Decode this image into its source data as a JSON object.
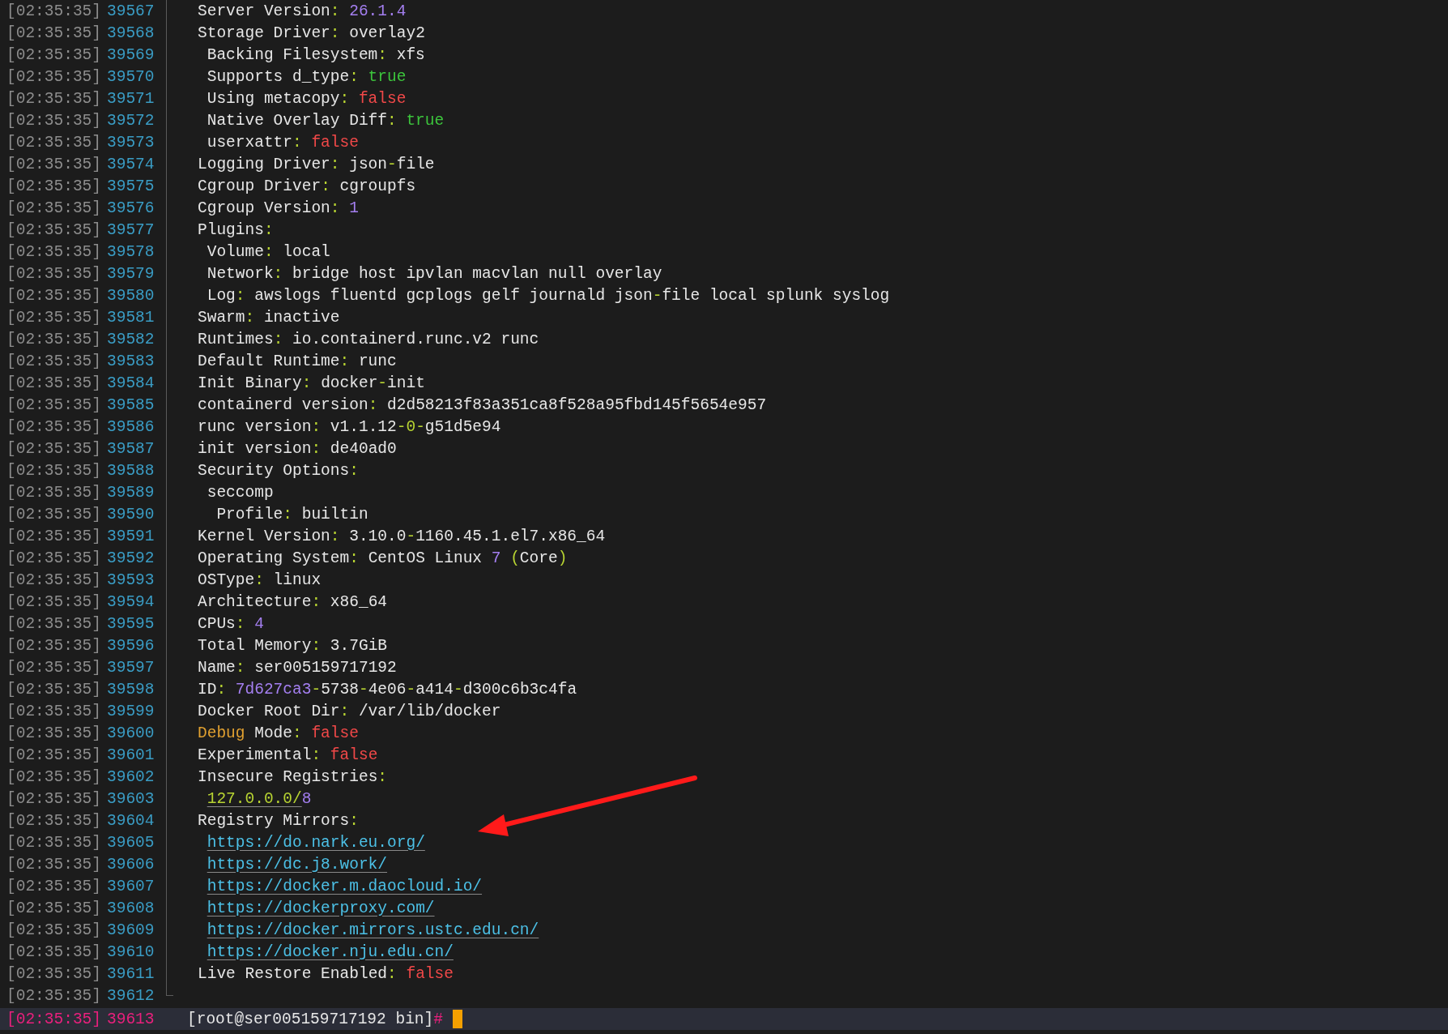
{
  "lines": [
    {
      "time": "[02:35:35]",
      "number": "39567",
      "segments": [
        {
          "kind": "text",
          "text": "Server Version"
        },
        {
          "kind": "punct",
          "text": ":"
        },
        {
          "kind": "number",
          "text": "26.1.4"
        }
      ]
    },
    {
      "time": "[02:35:35]",
      "number": "39568",
      "segments": [
        {
          "kind": "text",
          "text": "Storage Driver"
        },
        {
          "kind": "punct",
          "text": ":"
        },
        {
          "kind": "text",
          "text": "overlay2"
        }
      ],
      "children": [
        {
          "time": "[02:35:35]",
          "number": "39569",
          "segments": [
            {
              "kind": "text",
              "text": "Backing Filesystem"
            },
            {
              "kind": "punct",
              "text": ":"
            },
            {
              "kind": "text",
              "text": "xfs"
            }
          ]
        },
        {
          "time": "[02:35:35]",
          "number": "39570",
          "segments": [
            {
              "kind": "text",
              "text": "Supports d_type"
            },
            {
              "kind": "punct",
              "text": ":"
            },
            {
              "kind": "true",
              "text": "true"
            }
          ]
        },
        {
          "time": "[02:35:35]",
          "number": "39571",
          "segments": [
            {
              "kind": "text",
              "text": "Using metacopy"
            },
            {
              "kind": "punct",
              "text": ":"
            },
            {
              "kind": "false",
              "text": "false"
            }
          ]
        },
        {
          "time": "[02:35:35]",
          "number": "39572",
          "segments": [
            {
              "kind": "text",
              "text": "Native Overlay Diff"
            },
            {
              "kind": "punct",
              "text": ":"
            },
            {
              "kind": "true",
              "text": "true"
            }
          ]
        },
        {
          "time": "[02:35:35]",
          "number": "39573",
          "segments": [
            {
              "kind": "text",
              "text": "userxattr"
            },
            {
              "kind": "punct",
              "text": ":"
            },
            {
              "kind": "false",
              "text": "false"
            }
          ]
        }
      ]
    },
    {
      "time": "[02:35:35]",
      "number": "39574",
      "segments": [
        {
          "kind": "text",
          "text": "Logging Driver"
        },
        {
          "kind": "punct",
          "text": ":"
        },
        {
          "kind": "text",
          "text": "json"
        },
        {
          "kind": "dash",
          "text": "-"
        },
        {
          "kind": "text",
          "text": "file"
        }
      ]
    },
    {
      "time": "[02:35:35]",
      "number": "39575",
      "segments": [
        {
          "kind": "text",
          "text": "Cgroup Driver"
        },
        {
          "kind": "punct",
          "text": ":"
        },
        {
          "kind": "text",
          "text": "cgroupfs"
        }
      ]
    },
    {
      "time": "[02:35:35]",
      "number": "39576",
      "segments": [
        {
          "kind": "text",
          "text": "Cgroup Version"
        },
        {
          "kind": "punct",
          "text": ":"
        },
        {
          "kind": "number",
          "text": "1"
        }
      ]
    },
    {
      "time": "[02:35:35]",
      "number": "39577",
      "segments": [
        {
          "kind": "text",
          "text": "Plugins"
        },
        {
          "kind": "punct",
          "text": ":"
        }
      ],
      "children": [
        {
          "time": "[02:35:35]",
          "number": "39578",
          "segments": [
            {
              "kind": "text",
              "text": "Volume"
            },
            {
              "kind": "punct",
              "text": ":"
            },
            {
              "kind": "text",
              "text": "local"
            }
          ]
        },
        {
          "time": "[02:35:35]",
          "number": "39579",
          "segments": [
            {
              "kind": "text",
              "text": "Network"
            },
            {
              "kind": "punct",
              "text": ":"
            },
            {
              "kind": "text",
              "text": "bridge host ipvlan macvlan null overlay"
            }
          ]
        },
        {
          "time": "[02:35:35]",
          "number": "39580",
          "segments": [
            {
              "kind": "text",
              "text": "Log"
            },
            {
              "kind": "punct",
              "text": ":"
            },
            {
              "kind": "text",
              "text": "awslogs fluentd gcplogs gelf journald json"
            },
            {
              "kind": "dash",
              "text": "-"
            },
            {
              "kind": "text",
              "text": "file local splunk syslog"
            }
          ]
        }
      ]
    },
    {
      "time": "[02:35:35]",
      "number": "39581",
      "segments": [
        {
          "kind": "text",
          "text": "Swarm"
        },
        {
          "kind": "punct",
          "text": ":"
        },
        {
          "kind": "text",
          "text": "inactive"
        }
      ]
    },
    {
      "time": "[02:35:35]",
      "number": "39582",
      "segments": [
        {
          "kind": "text",
          "text": "Runtimes"
        },
        {
          "kind": "punct",
          "text": ":"
        },
        {
          "kind": "text",
          "text": "io.containerd.runc.v2 runc"
        }
      ]
    },
    {
      "time": "[02:35:35]",
      "number": "39583",
      "segments": [
        {
          "kind": "text",
          "text": "Default Runtime"
        },
        {
          "kind": "punct",
          "text": ":"
        },
        {
          "kind": "text",
          "text": "runc"
        }
      ]
    },
    {
      "time": "[02:35:35]",
      "number": "39584",
      "segments": [
        {
          "kind": "text",
          "text": "Init Binary"
        },
        {
          "kind": "punct",
          "text": ":"
        },
        {
          "kind": "text",
          "text": "docker"
        },
        {
          "kind": "dash",
          "text": "-"
        },
        {
          "kind": "text",
          "text": "init"
        }
      ]
    },
    {
      "time": "[02:35:35]",
      "number": "39585",
      "segments": [
        {
          "kind": "text",
          "text": "containerd version"
        },
        {
          "kind": "punct",
          "text": ":"
        },
        {
          "kind": "text",
          "text": "d2d58213f83a351ca8f528a95fbd145f5654e957"
        }
      ]
    },
    {
      "time": "[02:35:35]",
      "number": "39586",
      "segments": [
        {
          "kind": "text",
          "text": "runc version"
        },
        {
          "kind": "punct",
          "text": ":"
        },
        {
          "kind": "text",
          "text": "v1.1.12"
        },
        {
          "kind": "dash",
          "text": "-0-"
        },
        {
          "kind": "text",
          "text": "g51d5e94"
        }
      ]
    },
    {
      "time": "[02:35:35]",
      "number": "39587",
      "segments": [
        {
          "kind": "text",
          "text": "init version"
        },
        {
          "kind": "punct",
          "text": ":"
        },
        {
          "kind": "text",
          "text": "de40ad0"
        }
      ]
    },
    {
      "time": "[02:35:35]",
      "number": "39588",
      "segments": [
        {
          "kind": "text",
          "text": "Security Options"
        },
        {
          "kind": "punct",
          "text": ":"
        }
      ],
      "children": [
        {
          "time": "[02:35:35]",
          "number": "39589",
          "segments": [
            {
              "kind": "text",
              "text": "seccomp"
            }
          ],
          "children": [
            {
              "time": "[02:35:35]",
              "number": "39590",
              "segments": [
                {
                  "kind": "text",
                  "text": "Profile"
                },
                {
                  "kind": "punct",
                  "text": ":"
                },
                {
                  "kind": "text",
                  "text": "builtin"
                }
              ]
            }
          ]
        }
      ]
    },
    {
      "time": "[02:35:35]",
      "number": "39591",
      "segments": [
        {
          "kind": "text",
          "text": "Kernel Version"
        },
        {
          "kind": "punct",
          "text": ":"
        },
        {
          "kind": "text",
          "text": "3.10.0"
        },
        {
          "kind": "dash",
          "text": "-"
        },
        {
          "kind": "text",
          "text": "1160.45.1.el7.x86_64"
        }
      ]
    },
    {
      "time": "[02:35:35]",
      "number": "39592",
      "segments": [
        {
          "kind": "text",
          "text": "Operating System"
        },
        {
          "kind": "punct",
          "text": ":"
        },
        {
          "kind": "text",
          "text": "CentOS Linux "
        },
        {
          "kind": "number",
          "text": "7"
        },
        {
          "kind": "dash",
          "text": " ("
        },
        {
          "kind": "text",
          "text": "Core"
        },
        {
          "kind": "dash",
          "text": ")"
        }
      ]
    },
    {
      "time": "[02:35:35]",
      "number": "39593",
      "segments": [
        {
          "kind": "text",
          "text": "OSType"
        },
        {
          "kind": "punct",
          "text": ":"
        },
        {
          "kind": "text",
          "text": "linux"
        }
      ]
    },
    {
      "time": "[02:35:35]",
      "number": "39594",
      "segments": [
        {
          "kind": "text",
          "text": "Architecture"
        },
        {
          "kind": "punct",
          "text": ":"
        },
        {
          "kind": "text",
          "text": "x86_64"
        }
      ]
    },
    {
      "time": "[02:35:35]",
      "number": "39595",
      "segments": [
        {
          "kind": "text",
          "text": "CPUs"
        },
        {
          "kind": "punct",
          "text": ":"
        },
        {
          "kind": "number",
          "text": "4"
        }
      ]
    },
    {
      "time": "[02:35:35]",
      "number": "39596",
      "segments": [
        {
          "kind": "text",
          "text": "Total Memory"
        },
        {
          "kind": "punct",
          "text": ":"
        },
        {
          "kind": "text",
          "text": "3.7GiB"
        }
      ]
    },
    {
      "time": "[02:35:35]",
      "number": "39597",
      "segments": [
        {
          "kind": "text",
          "text": "Name"
        },
        {
          "kind": "punct",
          "text": ":"
        },
        {
          "kind": "text",
          "text": "ser005159717192"
        }
      ]
    },
    {
      "time": "[02:35:35]",
      "number": "39598",
      "segments": [
        {
          "kind": "text",
          "text": "ID"
        },
        {
          "kind": "punct",
          "text": ":"
        },
        {
          "kind": "number",
          "text": "7d627ca3"
        },
        {
          "kind": "dash",
          "text": "-"
        },
        {
          "kind": "text",
          "text": "5738"
        },
        {
          "kind": "dash",
          "text": "-"
        },
        {
          "kind": "text",
          "text": "4e06"
        },
        {
          "kind": "dash",
          "text": "-"
        },
        {
          "kind": "text",
          "text": "a414"
        },
        {
          "kind": "dash",
          "text": "-"
        },
        {
          "kind": "text",
          "text": "d300c6b3c4fa"
        }
      ]
    },
    {
      "time": "[02:35:35]",
      "number": "39599",
      "segments": [
        {
          "kind": "text",
          "text": "Docker Root Dir"
        },
        {
          "kind": "punct",
          "text": ":"
        },
        {
          "kind": "text",
          "text": "/var/lib/docker"
        }
      ]
    },
    {
      "time": "[02:35:35]",
      "number": "39600",
      "segments": [
        {
          "kind": "keyword",
          "text": "Debug"
        },
        {
          "kind": "text",
          "text": " Mode"
        },
        {
          "kind": "punct",
          "text": ":"
        },
        {
          "kind": "false",
          "text": "false"
        }
      ]
    },
    {
      "time": "[02:35:35]",
      "number": "39601",
      "segments": [
        {
          "kind": "text",
          "text": "Experimental"
        },
        {
          "kind": "punct",
          "text": ":"
        },
        {
          "kind": "false",
          "text": "false"
        }
      ]
    },
    {
      "time": "[02:35:35]",
      "number": "39602",
      "segments": [
        {
          "kind": "text",
          "text": "Insecure Registries"
        },
        {
          "kind": "punct",
          "text": ":"
        }
      ],
      "children": [
        {
          "time": "[02:35:35]",
          "number": "39603",
          "segments": [
            {
              "kind": "ip-link",
              "text": "127.0.0.0/"
            },
            {
              "kind": "number",
              "text": "8"
            }
          ]
        }
      ]
    },
    {
      "time": "[02:35:35]",
      "number": "39604",
      "segments": [
        {
          "kind": "text",
          "text": "Registry Mirrors"
        },
        {
          "kind": "punct",
          "text": ":"
        }
      ],
      "children": [
        {
          "time": "[02:35:35]",
          "number": "39605",
          "segments": [
            {
              "kind": "link",
              "text": "https://do.nark.eu.org/"
            }
          ]
        },
        {
          "time": "[02:35:35]",
          "number": "39606",
          "segments": [
            {
              "kind": "link",
              "text": "https://dc.j8.work/"
            }
          ]
        },
        {
          "time": "[02:35:35]",
          "number": "39607",
          "segments": [
            {
              "kind": "link",
              "text": "https://docker.m.daocloud.io/"
            }
          ]
        },
        {
          "time": "[02:35:35]",
          "number": "39608",
          "segments": [
            {
              "kind": "link",
              "text": "https://dockerproxy.com/"
            }
          ]
        },
        {
          "time": "[02:35:35]",
          "number": "39609",
          "segments": [
            {
              "kind": "link",
              "text": "https://docker.mirrors.ustc.edu.cn/"
            }
          ]
        },
        {
          "time": "[02:35:35]",
          "number": "39610",
          "segments": [
            {
              "kind": "link",
              "text": "https://docker.nju.edu.cn/"
            }
          ]
        }
      ]
    },
    {
      "time": "[02:35:35]",
      "number": "39611",
      "segments": [
        {
          "kind": "text",
          "text": "Live Restore Enabled"
        },
        {
          "kind": "punct",
          "text": ":"
        },
        {
          "kind": "false",
          "text": "false"
        }
      ]
    },
    {
      "time": "[02:35:35]",
      "number": "39612"
    }
  ],
  "prompt": {
    "time": "[02:35:35]",
    "number": "39613",
    "text": "[root@ser005159717192 bin]",
    "symbol": "#"
  }
}
